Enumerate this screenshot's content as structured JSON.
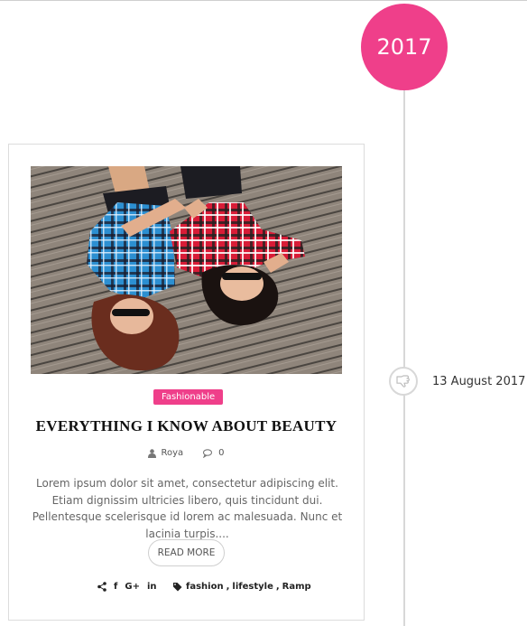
{
  "timeline": {
    "year": "2017",
    "date": "13 August 2017"
  },
  "post": {
    "category": "Fashionable",
    "title": "EVERYTHING I KNOW ABOUT BEAUTY",
    "author": "Roya",
    "comments": "0",
    "excerpt": "Lorem ipsum dolor sit amet, consectetur adipiscing elit. Etiam dignissim ultricies libero, quis tincidunt dui. Pellentesque scelerisque id lorem ac malesuada. Nunc et lacinia turpis....",
    "read_more": "READ MORE",
    "share_facebook": "f",
    "share_google": "G+",
    "share_linkedin": "in",
    "tags": [
      "fashion",
      "lifestyle",
      "Ramp"
    ]
  },
  "colors": {
    "accent": "#ef3f8a",
    "timeline_line": "#d8d8d8"
  },
  "icons": {
    "node": "thumbs-down-icon",
    "author": "user-icon",
    "comments": "comments-icon",
    "share": "share-icon",
    "tags": "tags-icon"
  }
}
